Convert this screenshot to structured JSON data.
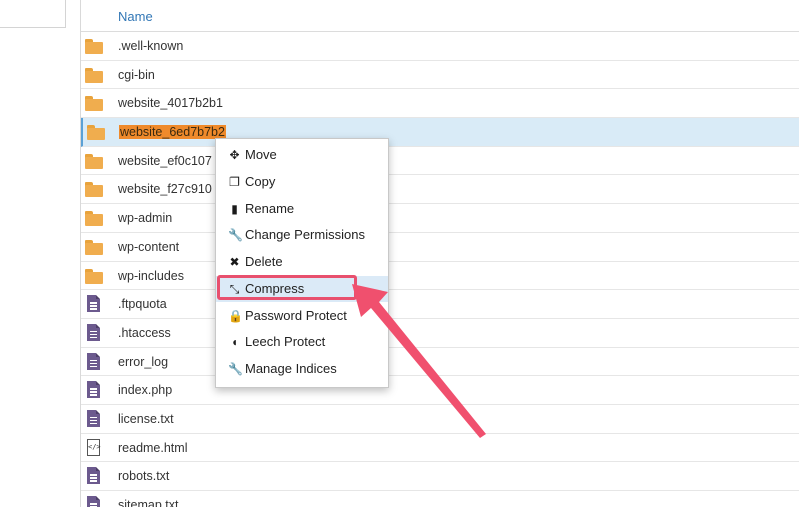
{
  "table": {
    "header_name": "Name",
    "rows": [
      {
        "name": ".well-known",
        "type": "folder"
      },
      {
        "name": "cgi-bin",
        "type": "folder"
      },
      {
        "name": "website_4017b2b1",
        "type": "folder"
      },
      {
        "name": "website_6ed7b7b2",
        "type": "folder",
        "selected": true
      },
      {
        "name": "website_ef0c107",
        "type": "folder"
      },
      {
        "name": "website_f27c910",
        "type": "folder"
      },
      {
        "name": "wp-admin",
        "type": "folder"
      },
      {
        "name": "wp-content",
        "type": "folder"
      },
      {
        "name": "wp-includes",
        "type": "folder"
      },
      {
        "name": ".ftpquota",
        "type": "file"
      },
      {
        "name": ".htaccess",
        "type": "file"
      },
      {
        "name": "error_log",
        "type": "file"
      },
      {
        "name": "index.php",
        "type": "file"
      },
      {
        "name": "license.txt",
        "type": "file"
      },
      {
        "name": "readme.html",
        "type": "code-file"
      },
      {
        "name": "robots.txt",
        "type": "file"
      },
      {
        "name": "sitemap.txt",
        "type": "file"
      }
    ]
  },
  "context_menu": {
    "items": [
      {
        "label": "Move",
        "icon": "move-icon",
        "glyph": "✥"
      },
      {
        "label": "Copy",
        "icon": "copy-icon",
        "glyph": "❐"
      },
      {
        "label": "Rename",
        "icon": "file-icon",
        "glyph": "▮"
      },
      {
        "label": "Change Permissions",
        "icon": "wrench-icon",
        "glyph": "🔧"
      },
      {
        "label": "Delete",
        "icon": "close-icon",
        "glyph": "✖"
      },
      {
        "label": "Compress",
        "icon": "compress-icon",
        "glyph": "⤡",
        "highlighted": true
      },
      {
        "label": "Password Protect",
        "icon": "lock-icon",
        "glyph": "🔒"
      },
      {
        "label": "Leech Protect",
        "icon": "shield-icon",
        "glyph": "◖"
      },
      {
        "label": "Manage Indices",
        "icon": "wrench-icon",
        "glyph": "🔧"
      }
    ]
  },
  "colors": {
    "link_blue": "#3277b6",
    "folder": "#f0ad4e",
    "file": "#6c5a8e",
    "selected_row": "#d9ebf7",
    "selected_name_highlight": "#ef8a2b",
    "annotation": "#e8506e"
  }
}
